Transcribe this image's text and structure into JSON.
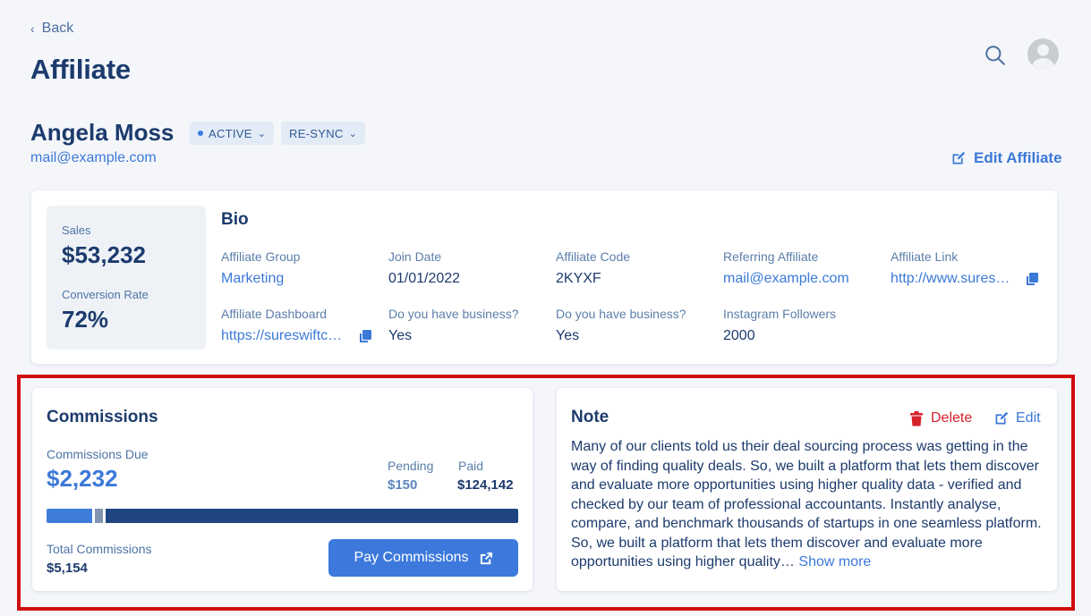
{
  "nav": {
    "back_label": "Back",
    "page_title": "Affiliate"
  },
  "header_icons": {
    "search": "search-icon",
    "avatar": "user-avatar"
  },
  "affiliate": {
    "name": "Angela Moss",
    "status_label": "ACTIVE",
    "resync_label": "RE-SYNC",
    "email": "mail@example.com",
    "edit_label": "Edit Affiliate"
  },
  "stats": {
    "sales_label": "Sales",
    "sales_value": "$53,232",
    "conversion_label": "Conversion Rate",
    "conversion_value": "72%"
  },
  "bio": {
    "title": "Bio",
    "fields": [
      {
        "label": "Affiliate Group",
        "value": "Marketing"
      },
      {
        "label": "Join Date",
        "value": "01/01/2022"
      },
      {
        "label": "Affiliate Code",
        "value": "2KYXF"
      },
      {
        "label": "Referring Affiliate",
        "value": "mail@example.com"
      },
      {
        "label": "Affiliate Link",
        "value": "http://www.sures…"
      },
      {
        "label": "Affiliate Dashboard",
        "value": "https://sureswiftc…"
      },
      {
        "label": "Do you have business?",
        "value": "Yes"
      },
      {
        "label": "Do you have business?",
        "value": "Yes"
      },
      {
        "label": "Instagram Followers",
        "value": "2000"
      }
    ]
  },
  "commissions": {
    "title": "Commissions",
    "due_label": "Commissions Due",
    "due_value": "$2,232",
    "pending_label": "Pending",
    "pending_value": "$150",
    "paid_label": "Paid",
    "paid_value": "$124,142",
    "total_label": "Total Commissions",
    "total_value": "$5,154",
    "pay_label": "Pay Commissions",
    "bar": {
      "due_fraction": 0.097,
      "pending_fraction": 0.017,
      "paid_fraction": 0.886
    },
    "colors": {
      "due": "#3f7ddc",
      "pending": "#7f95b2",
      "paid": "#1f4580"
    }
  },
  "note": {
    "title": "Note",
    "delete_label": "Delete",
    "edit_label": "Edit",
    "text": "Many of our clients told us their deal sourcing process was getting in the way of finding quality deals. So, we built a platform that lets them discover and evaluate more opportunities using higher quality data - verified and checked by our team of professional accountants. Instantly analyse, compare, and benchmark thousands of startups in one seamless platform. So, we built a platform that lets them discover and evaluate more opportunities using higher quality…",
    "show_more_label": "Show more"
  },
  "colors": {
    "primary": "#3d79dc",
    "heading": "#1c3b6d",
    "danger": "#d6212b",
    "highlight_border": "#d10d0d"
  }
}
